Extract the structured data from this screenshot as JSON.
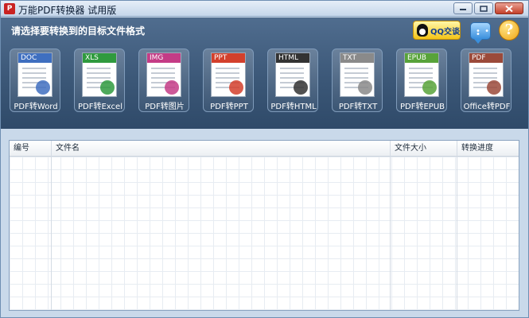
{
  "window": {
    "title": "万能PDF转换器 试用版",
    "app_icon_glyph": "P"
  },
  "toolbar": {
    "prompt": "请选择要转换到的目标文件格式",
    "qq_label": "QQ交谈",
    "help_glyph": "?"
  },
  "formats": [
    {
      "tag": "DOC",
      "label": "PDF转Word",
      "color": "#3f6fc0",
      "icon": "word-doc-icon"
    },
    {
      "tag": "XLS",
      "label": "PDF转Excel",
      "color": "#2f9a3e",
      "icon": "excel-chart-icon"
    },
    {
      "tag": "IMG",
      "label": "PDF转图片",
      "color": "#c43c86",
      "icon": "image-icon"
    },
    {
      "tag": "PPT",
      "label": "PDF转PPT",
      "color": "#d3402c",
      "icon": "ppt-icon"
    },
    {
      "tag": "HTML",
      "label": "PDF转HTML",
      "color": "#333333",
      "icon": "html-globe-icon"
    },
    {
      "tag": "TXT",
      "label": "PDF转TXT",
      "color": "#8a8a8a",
      "icon": "txt-pen-icon"
    },
    {
      "tag": "EPUB",
      "label": "PDF转EPUB",
      "color": "#58a33a",
      "icon": "epub-icon"
    },
    {
      "tag": "PDF",
      "label": "Office转PDF",
      "color": "#9b4a3a",
      "icon": "pdf-acrobat-icon"
    }
  ],
  "table": {
    "columns": [
      "编号",
      "文件名",
      "文件大小",
      "转换进度"
    ],
    "rows": []
  },
  "colors": {
    "toolbar_bg": "#3a5676",
    "titlebar": "#c5d6ea",
    "close_button": "#c4402a"
  }
}
